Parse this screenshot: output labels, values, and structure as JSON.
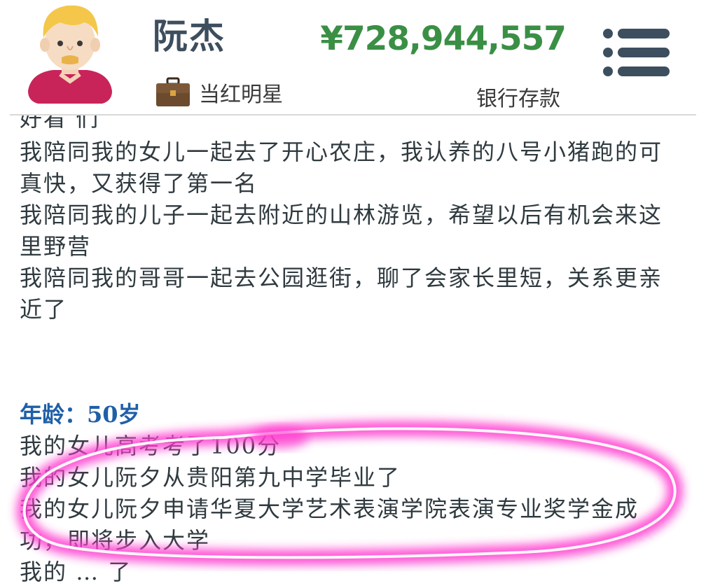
{
  "profile": {
    "name": "阮杰",
    "job": "当红明星",
    "balance": "¥728,944,557",
    "balance_label": "银行存款"
  },
  "log_top_cut": "好看 们",
  "log_entries": [
    "我陪同我的女儿一起去了开心农庄，我认养的八号小猪跑的可真快，又获得了第一名",
    "我陪同我的儿子一起去附近的山林游览，希望以后有机会来这里野营",
    "我陪同我的哥哥一起去公园逛街，聊了会家长里短，关系更亲近了"
  ],
  "age_label": "年龄：50岁",
  "age_entries": [
    "我的女儿高考考了100分",
    "我的女儿阮夕从贵阳第九中学毕业了",
    "我的女儿阮夕申请华夏大学艺术表演学院表演专业奖学金成功，即将步入大学",
    "我的 … 了"
  ],
  "colors": {
    "balance": "#3a8f45",
    "age": "#1f5fa8",
    "text": "#2f3a3f",
    "highlight": "#ff3fd0"
  },
  "icons": {
    "avatar": "cartoon-man-avatar",
    "job": "briefcase-icon",
    "menu": "hamburger-menu-icon"
  }
}
